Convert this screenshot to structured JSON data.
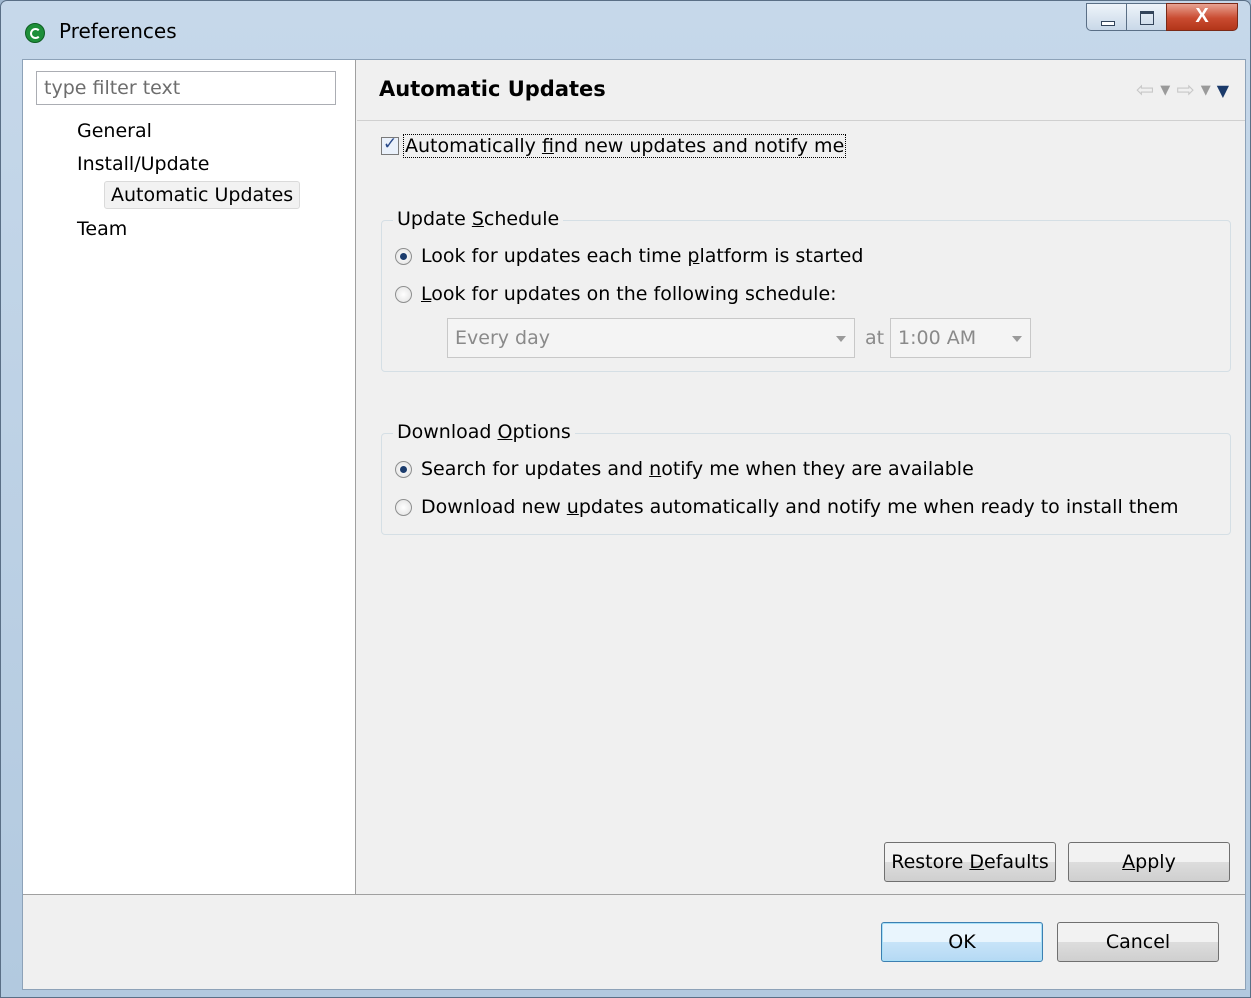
{
  "window": {
    "title": "Preferences",
    "close_glyph": "X"
  },
  "sidebar": {
    "filter_placeholder": "type filter text",
    "items": [
      {
        "label": "General",
        "level": 0
      },
      {
        "label": "Install/Update",
        "level": 0
      },
      {
        "label": "Automatic Updates",
        "level": 1,
        "selected": true
      },
      {
        "label": "Team",
        "level": 0
      }
    ]
  },
  "page": {
    "title": "Automatic Updates",
    "auto_check": {
      "label_pre": "Automatically ",
      "label_mnemonic": "f",
      "label_post": "ind new updates and notify me",
      "checked": true
    },
    "schedule_group": {
      "title_pre": "Update ",
      "title_mnemonic": "S",
      "title_post": "chedule",
      "option1_pre": "Look for updates each time ",
      "option1_mnemonic": "p",
      "option1_post": "latform is started",
      "option1_selected": true,
      "option2_pre": "",
      "option2_mnemonic": "L",
      "option2_post": "ook for updates on the following schedule:",
      "option2_selected": false,
      "day_value": "Every day",
      "at_label": "at",
      "time_value": "1:00 AM"
    },
    "download_group": {
      "title_pre": "Download ",
      "title_mnemonic": "O",
      "title_post": "ptions",
      "option1_pre": "Search for updates and ",
      "option1_mnemonic": "n",
      "option1_post": "otify me when they are available",
      "option1_selected": true,
      "option2_pre": "Download new ",
      "option2_mnemonic": "u",
      "option2_post": "pdates automatically and notify me when ready to install them",
      "option2_selected": false
    },
    "restore_pre": "Restore ",
    "restore_mnemonic": "D",
    "restore_post": "efaults",
    "apply_mnemonic": "A",
    "apply_post": "pply"
  },
  "footer": {
    "ok_label": "OK",
    "cancel_label": "Cancel"
  },
  "icons": {
    "back": "back-arrow-icon",
    "forward": "forward-arrow-icon",
    "menu": "view-menu-icon"
  },
  "colors": {
    "title_bar": "#b8cde2",
    "dialog_bg": "#f0f0f0",
    "default_button_border": "#3c7fb1",
    "close_button": "#c94b30"
  }
}
